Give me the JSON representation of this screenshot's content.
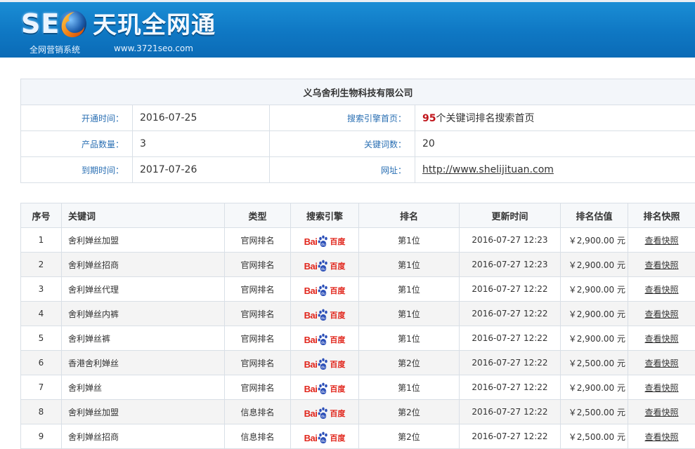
{
  "header": {
    "logo_seo": "SEO",
    "title": "天玑全网通",
    "subtitle": "全网营销系统",
    "url": "www.3721seo.com"
  },
  "info": {
    "company": "义乌舍利生物科技有限公司",
    "rows": [
      {
        "label1": "开通时间：",
        "value1": "2016-07-25",
        "label2": "搜索引擎首页：",
        "value2_num": "95",
        "value2_text": "个关键词排名搜索首页"
      },
      {
        "label1": "产品数量：",
        "value1": "3",
        "label2": "关键词数：",
        "value2": "20"
      },
      {
        "label1": "到期时间：",
        "value1": "2017-07-26",
        "label2": "网址：",
        "value2_link": "http://www.shelijituan.com"
      }
    ]
  },
  "rank_table": {
    "headers": [
      "序号",
      "关键词",
      "类型",
      "搜索引擎",
      "排名",
      "更新时间",
      "排名估值",
      "排名快照"
    ],
    "engine_logo": {
      "bai": "Bai",
      "du": "百度"
    },
    "rows": [
      {
        "no": "1",
        "keyword": "舍利婵丝加盟",
        "type": "官网排名",
        "rank": "第1位",
        "time": "2016-07-27 12:23",
        "price": "￥2,900.00 元",
        "snap": "查看快照"
      },
      {
        "no": "2",
        "keyword": "舍利婵丝招商",
        "type": "官网排名",
        "rank": "第1位",
        "time": "2016-07-27 12:23",
        "price": "￥2,900.00 元",
        "snap": "查看快照"
      },
      {
        "no": "3",
        "keyword": "舍利婵丝代理",
        "type": "官网排名",
        "rank": "第1位",
        "time": "2016-07-27 12:22",
        "price": "￥2,900.00 元",
        "snap": "查看快照"
      },
      {
        "no": "4",
        "keyword": "舍利婵丝内裤",
        "type": "官网排名",
        "rank": "第1位",
        "time": "2016-07-27 12:22",
        "price": "￥2,900.00 元",
        "snap": "查看快照"
      },
      {
        "no": "5",
        "keyword": "舍利婵丝裤",
        "type": "官网排名",
        "rank": "第1位",
        "time": "2016-07-27 12:22",
        "price": "￥2,900.00 元",
        "snap": "查看快照"
      },
      {
        "no": "6",
        "keyword": "香港舍利婵丝",
        "type": "官网排名",
        "rank": "第2位",
        "time": "2016-07-27 12:22",
        "price": "￥2,500.00 元",
        "snap": "查看快照"
      },
      {
        "no": "7",
        "keyword": "舍利婵丝",
        "type": "官网排名",
        "rank": "第1位",
        "time": "2016-07-27 12:22",
        "price": "￥2,900.00 元",
        "snap": "查看快照"
      },
      {
        "no": "8",
        "keyword": "舍利婵丝加盟",
        "type": "信息排名",
        "rank": "第2位",
        "time": "2016-07-27 12:22",
        "price": "￥2,500.00 元",
        "snap": "查看快照"
      },
      {
        "no": "9",
        "keyword": "舍利婵丝招商",
        "type": "信息排名",
        "rank": "第2位",
        "time": "2016-07-27 12:22",
        "price": "￥2,500.00 元",
        "snap": "查看快照"
      }
    ]
  }
}
